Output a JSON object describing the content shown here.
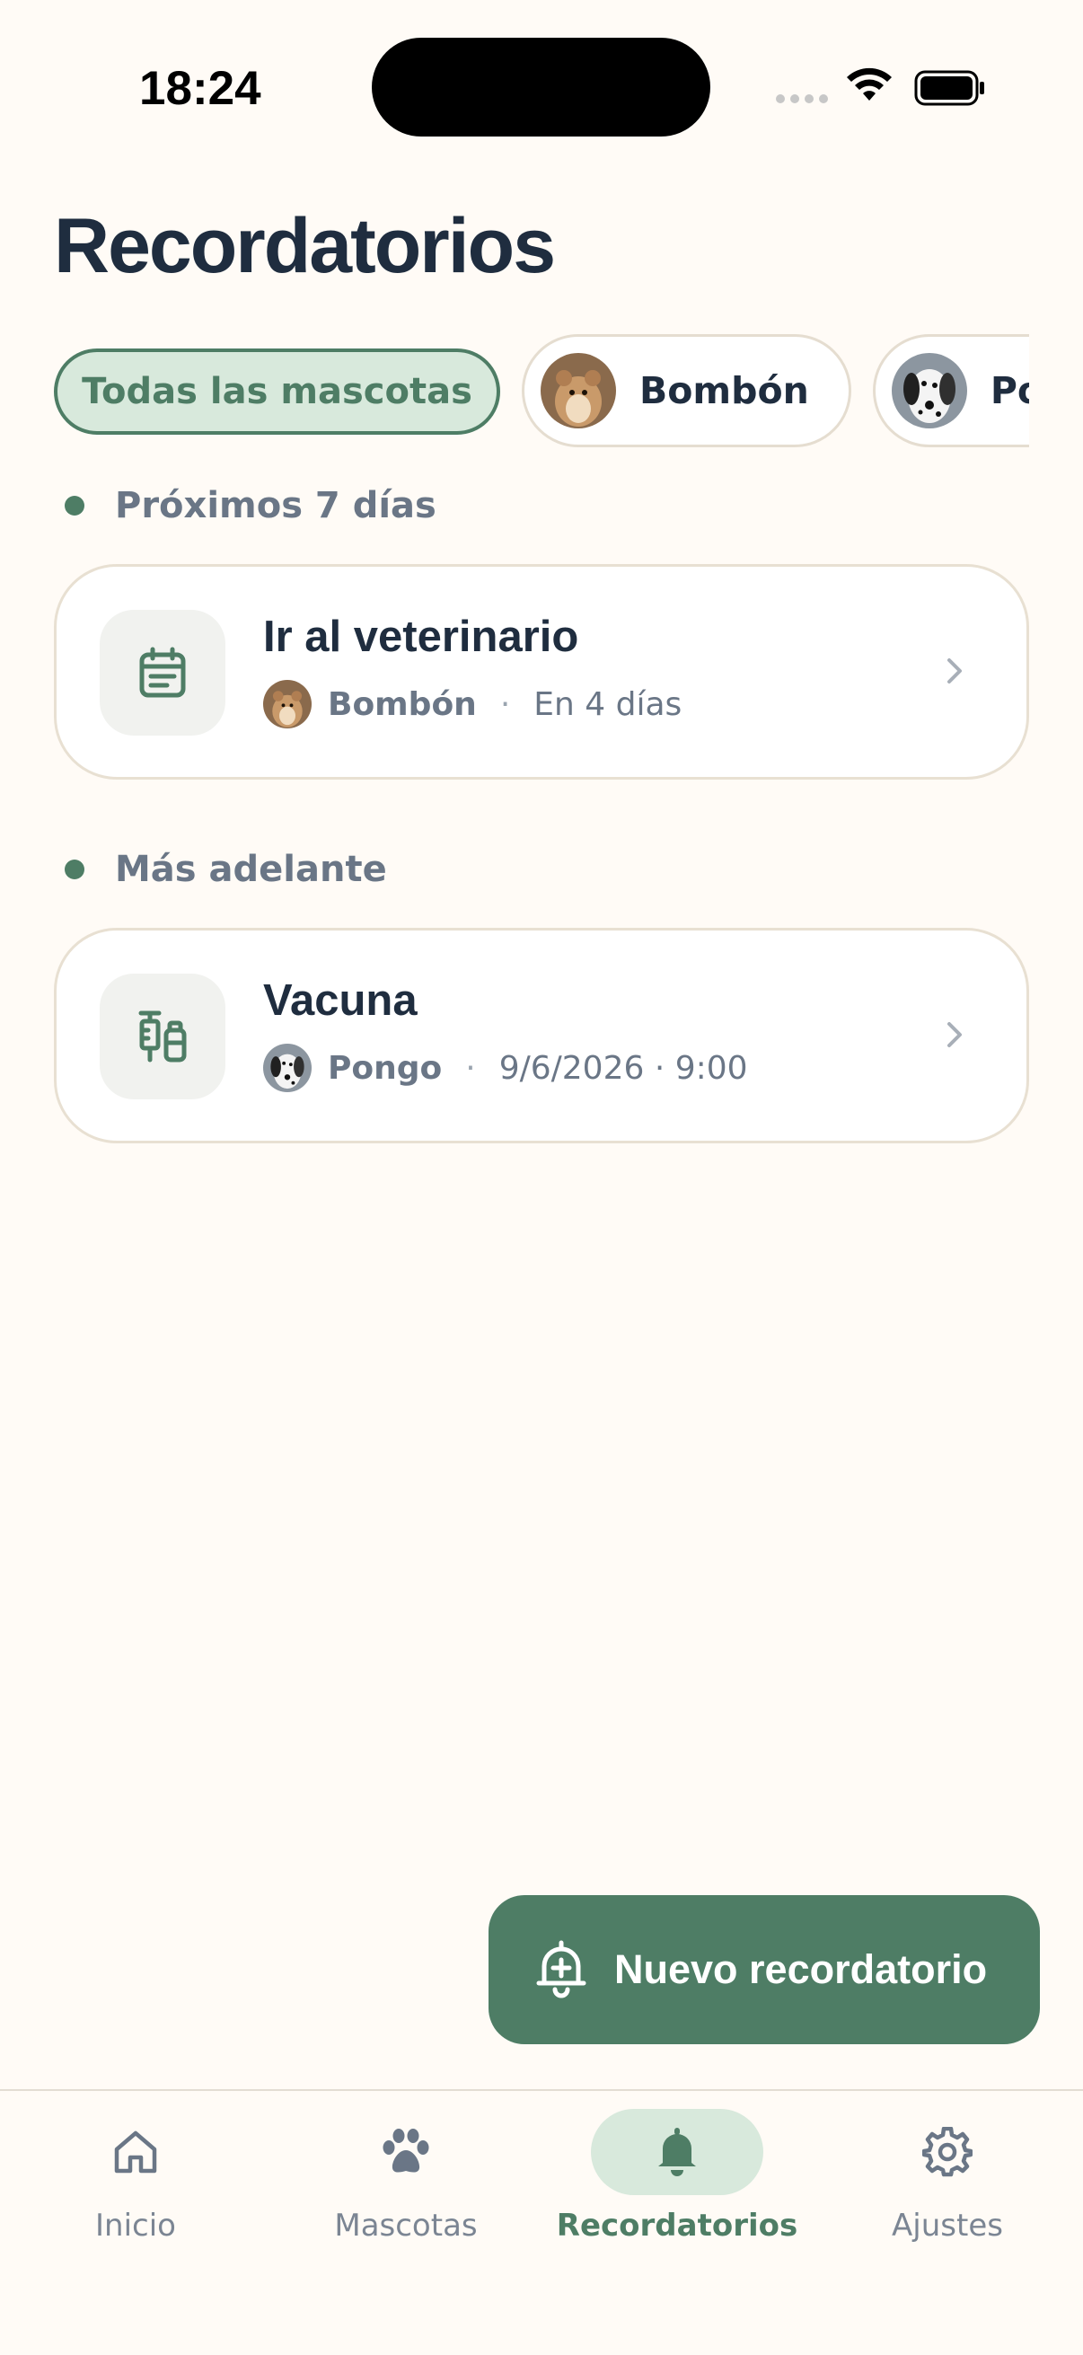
{
  "status_bar": {
    "time": "18:24"
  },
  "header": {
    "title": "Recordatorios"
  },
  "filters": [
    {
      "label": "Todas las mascotas",
      "active": true
    },
    {
      "label": "Bombón",
      "avatar": "hamster-photo"
    },
    {
      "label": "Pongo",
      "avatar": "dalmatian-photo"
    }
  ],
  "sections": [
    {
      "title": "Próximos 7 días",
      "items": [
        {
          "title": "Ir al veterinario",
          "icon": "calendar-icon",
          "pet": "Bombón",
          "pet_avatar": "hamster-photo",
          "when": "En 4 días"
        }
      ]
    },
    {
      "title": "Más adelante",
      "items": [
        {
          "title": "Vacuna",
          "icon": "vaccine-icon",
          "pet": "Pongo",
          "pet_avatar": "dalmatian-photo",
          "when": "9/6/2026 · 9:00"
        }
      ]
    }
  ],
  "fab": {
    "label": "Nuevo recordatorio",
    "icon": "bell-plus-icon"
  },
  "tabs": [
    {
      "label": "Inicio",
      "icon": "home-icon"
    },
    {
      "label": "Mascotas",
      "icon": "paw-icon"
    },
    {
      "label": "Recordatorios",
      "icon": "bell-icon",
      "active": true
    },
    {
      "label": "Ajustes",
      "icon": "gear-icon"
    }
  ],
  "colors": {
    "accent": "#4e7d65",
    "accent_light": "#d8e9dc",
    "background": "#fffbf6",
    "text": "#1f2d3f",
    "muted": "#6a7686"
  }
}
